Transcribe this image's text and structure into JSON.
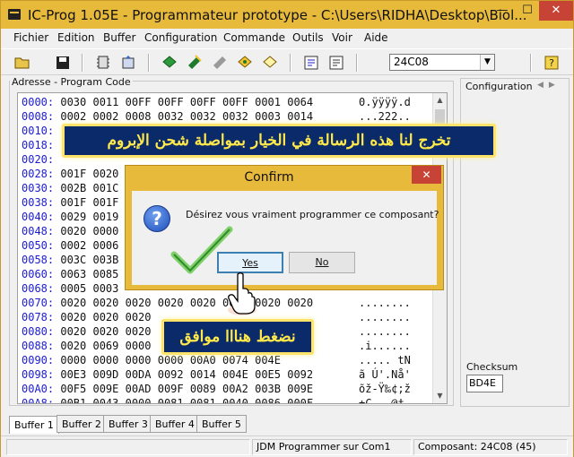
{
  "window": {
    "title": "IC-Prog 1.05E - Programmateur prototype - C:\\Users\\RIDHA\\Desktop\\Biol...",
    "controls": {
      "minimize": "—",
      "maximize": "☐",
      "close": "✕"
    }
  },
  "menu": [
    "Fichier",
    "Edition",
    "Buffer",
    "Configuration",
    "Commande",
    "Outils",
    "Voir",
    "Aide"
  ],
  "toolbar": {
    "device": "24C08"
  },
  "program_code": {
    "label": "Adresse - Program Code",
    "rows": [
      {
        "addr": "0000:",
        "data": "0030 0011 00FF 00FF 00FF 00FF 0001 0064",
        "ascii": "0.ÿÿÿÿ.d"
      },
      {
        "addr": "0008:",
        "data": "0002 0002 0008 0032 0032 0032 0003 0014",
        "ascii": "...222.."
      },
      {
        "addr": "0010:",
        "data": "",
        "ascii": ""
      },
      {
        "addr": "0018:",
        "data": "",
        "ascii": ""
      },
      {
        "addr": "0020:",
        "data": "",
        "ascii": ""
      },
      {
        "addr": "0028:",
        "data": "001F 0020",
        "ascii": ""
      },
      {
        "addr": "0030:",
        "data": "002B 001C",
        "ascii": ""
      },
      {
        "addr": "0038:",
        "data": "001F 001F",
        "ascii": ""
      },
      {
        "addr": "0040:",
        "data": "0029 0019",
        "ascii": ""
      },
      {
        "addr": "0048:",
        "data": "0020 0000",
        "ascii": ""
      },
      {
        "addr": "0050:",
        "data": "0002 0006",
        "ascii": ""
      },
      {
        "addr": "0058:",
        "data": "003C 003B",
        "ascii": ""
      },
      {
        "addr": "0060:",
        "data": "0063 0085",
        "ascii": ""
      },
      {
        "addr": "0068:",
        "data": "0005 0003",
        "ascii": ""
      },
      {
        "addr": "0070:",
        "data": "0020 0020 0020 0020 0020 0020 0020 0020",
        "ascii": "........"
      },
      {
        "addr": "0078:",
        "data": "0020 0020 0020",
        "ascii": "........"
      },
      {
        "addr": "0080:",
        "data": "0020 0020 0020",
        "ascii": "........"
      },
      {
        "addr": "0088:",
        "data": "0020 0069 0000",
        "ascii": ".i......"
      },
      {
        "addr": "0090:",
        "data": "0000 0000 0000 0000 00A0 0074 004E",
        "ascii": "..... tN"
      },
      {
        "addr": "0098:",
        "data": "00E3 009D 00DA 0092 0014 004E 00E5 0092",
        "ascii": "ã Ú'.Nå'"
      },
      {
        "addr": "00A0:",
        "data": "00F5 009E 00AD 009F 0089 00A2 003B 009E",
        "ascii": "õž-Ÿ‰¢;ž"
      },
      {
        "addr": "00A8:",
        "data": "00B1 0043 0000 0081 0081 0040 0086 000F",
        "ascii": "±C...@†."
      }
    ]
  },
  "configuration": {
    "label": "Configuration",
    "checksum_label": "Checksum",
    "checksum_value": "BD4E"
  },
  "tabs": [
    "Buffer 1",
    "Buffer 2",
    "Buffer 3",
    "Buffer 4",
    "Buffer 5"
  ],
  "status": {
    "programmer": "JDM Programmer sur Com1",
    "component": "Composant: 24C08  (45)"
  },
  "dialog": {
    "title": "Confirm",
    "close": "✕",
    "message": "Désirez vous vraiment programmer ce composant?",
    "yes_label": "Yes",
    "no_label": "No"
  },
  "annotations": {
    "top_text": "تخرج لنا هذه الرسالة في الخيار بمواصلة شحن الإبروم",
    "bottom_text": "نضغط هنااا موافق"
  },
  "colors": {
    "title_bar": "#e8ba3c",
    "address": "#1b1bd0",
    "banner_bg": "#0b2a6a",
    "banner_text": "#ffe84a",
    "close_red": "#c74336"
  }
}
